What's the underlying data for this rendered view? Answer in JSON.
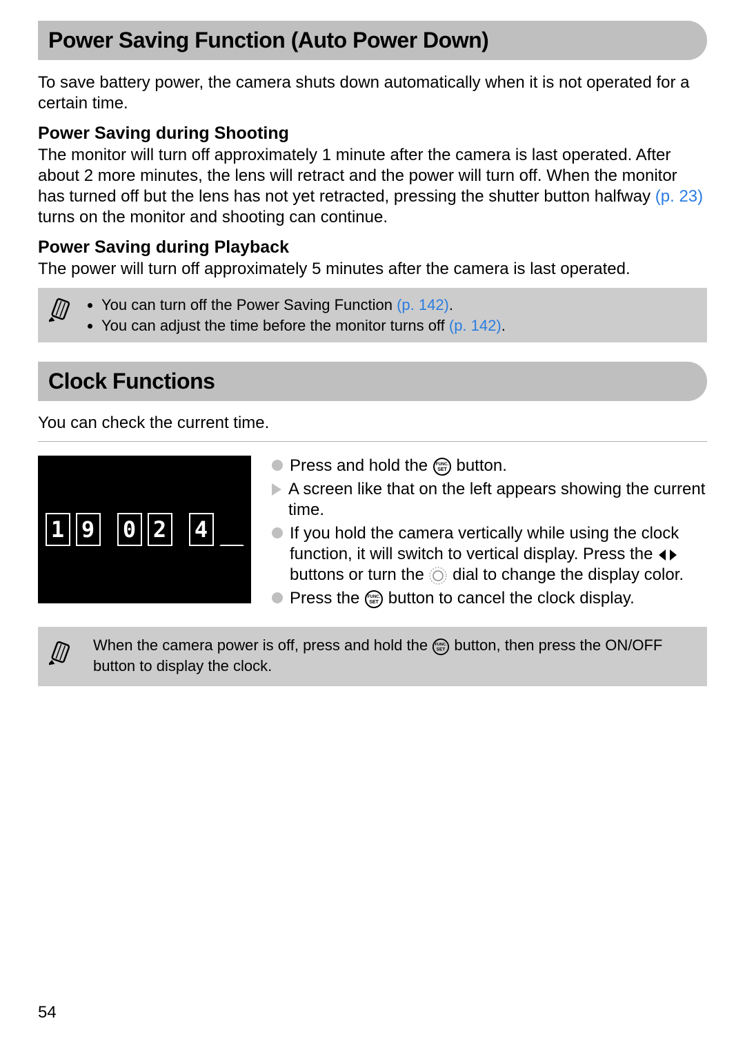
{
  "section1": {
    "heading": "Power Saving Function (Auto Power Down)",
    "intro": "To save battery power, the camera shuts down automatically when it is not operated for a certain time.",
    "sub1_heading": "Power Saving during Shooting",
    "sub1_text_a": "The monitor will turn off approximately 1 minute after the camera is last operated. After about 2 more minutes, the lens will retract and the power will turn off. When the monitor has turned off but the lens has not yet retracted, pressing the shutter button halfway ",
    "sub1_link": "(p. 23)",
    "sub1_text_b": " turns on the monitor and shooting can continue.",
    "sub2_heading": "Power Saving during Playback",
    "sub2_text": "The power will turn off approximately 5 minutes after the camera is last operated.",
    "note1_item1_a": "You can turn off the Power Saving Function ",
    "note1_item1_link": "(p. 142)",
    "note1_item1_b": ".",
    "note1_item2_a": "You can adjust the time before the monitor turns off ",
    "note1_item2_link": "(p. 142)",
    "note1_item2_b": "."
  },
  "section2": {
    "heading": "Clock Functions",
    "intro": "You can check the current time.",
    "digits": {
      "d1": "1",
      "d2": "9",
      "d3": "0",
      "d4": "2",
      "d5": "4",
      "d6": " "
    },
    "step1_a": "Press and hold the ",
    "step1_b": " button.",
    "step2": "A screen like that on the left appears showing the current time.",
    "step3_a": "If you hold the camera vertically while using the clock function, it will switch to vertical display. Press the ",
    "step3_b": " buttons or turn the ",
    "step3_c": " dial to change the display color.",
    "step4_a": "Press the ",
    "step4_b": " button to cancel the clock display.",
    "note2_a": "When the camera power is off, press and hold the ",
    "note2_b": " button, then press the ON/OFF button to display the clock."
  },
  "icons": {
    "func_set": "FUNC./SET button",
    "dial": "control dial",
    "left_right": "left/right buttons",
    "pencil": "note"
  },
  "page_number": "54"
}
